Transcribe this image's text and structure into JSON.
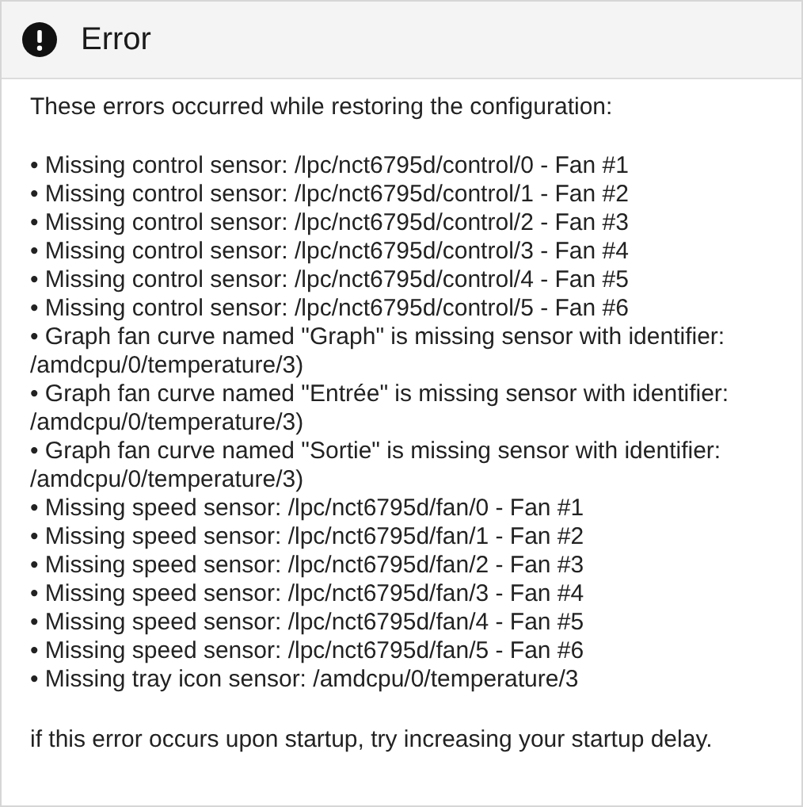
{
  "dialog": {
    "title": "Error",
    "intro": "These errors occurred while restoring the configuration:",
    "errors": [
      "• Missing control sensor: /lpc/nct6795d/control/0 - Fan #1",
      "• Missing control sensor: /lpc/nct6795d/control/1 - Fan #2",
      "• Missing control sensor: /lpc/nct6795d/control/2 - Fan #3",
      "• Missing control sensor: /lpc/nct6795d/control/3 - Fan #4",
      "• Missing control sensor: /lpc/nct6795d/control/4 - Fan #5",
      "• Missing control sensor: /lpc/nct6795d/control/5 - Fan #6",
      "• Graph fan curve named \"Graph\" is missing sensor with identifier: /amdcpu/0/temperature/3)",
      "• Graph fan curve named \"Entrée\" is missing sensor with identifier: /amdcpu/0/temperature/3)",
      "• Graph fan curve named \"Sortie\" is missing sensor with identifier: /amdcpu/0/temperature/3)",
      "• Missing speed sensor: /lpc/nct6795d/fan/0 - Fan #1",
      "• Missing speed sensor: /lpc/nct6795d/fan/1 - Fan #2",
      "• Missing speed sensor: /lpc/nct6795d/fan/2 - Fan #3",
      "• Missing speed sensor: /lpc/nct6795d/fan/3 - Fan #4",
      "• Missing speed sensor: /lpc/nct6795d/fan/4 - Fan #5",
      "• Missing speed sensor: /lpc/nct6795d/fan/5 - Fan #6",
      "• Missing tray icon sensor: /amdcpu/0/temperature/3"
    ],
    "footer": "if this error occurs upon startup, try increasing your startup delay."
  }
}
